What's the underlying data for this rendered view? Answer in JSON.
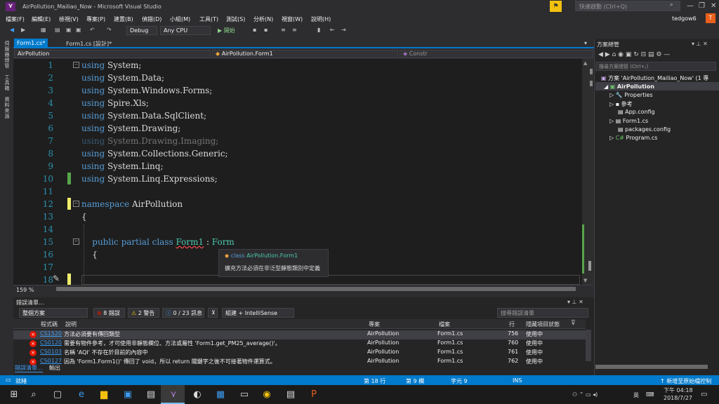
{
  "window": {
    "title": "AirPollution_Mailiao_Now - Microsoft Visual Studio",
    "quick_launch_placeholder": "快速啟動 (Ctrl+Q)",
    "user": "tedgow6",
    "avatar_letter": "T"
  },
  "menu": [
    "檔案(F)",
    "編輯(E)",
    "檢視(V)",
    "專案(P)",
    "建置(B)",
    "偵錯(D)",
    "小組(M)",
    "工具(T)",
    "測試(S)",
    "分析(N)",
    "視窗(W)",
    "說明(H)"
  ],
  "toolbar": {
    "config": "Debug",
    "platform": "Any CPU",
    "start_label": "開始"
  },
  "left_rail": [
    "伺服器總管",
    "工具箱",
    "資料來源"
  ],
  "tabs": [
    {
      "label": "Form1.cs*",
      "active": true
    },
    {
      "label": "Form1.cs [設計]*",
      "active": false
    }
  ],
  "nav": {
    "project": "AirPollution",
    "class": "AirPollution.Form1",
    "member": "Constr"
  },
  "editor": {
    "line_numbers": [
      "1",
      "2",
      "3",
      "4",
      "5",
      "6",
      "7",
      "8",
      "9",
      "10",
      "11",
      "12",
      "13",
      "14",
      "15",
      "16",
      "17",
      "18"
    ],
    "lines": [
      [
        "using",
        " System;"
      ],
      [
        "using",
        " System.Data;"
      ],
      [
        "using",
        " System.Windows.Forms;"
      ],
      [
        "using",
        " Spire.Xls;"
      ],
      [
        "using",
        " System.Data.SqlClient;"
      ],
      [
        "using",
        " System.Drawing;"
      ],
      [
        "using",
        " System.Drawing.Imaging;"
      ],
      [
        "using",
        " System.Collections.Generic;"
      ],
      [
        "using",
        " System.Linq;"
      ],
      [
        "using",
        " System.Linq.Expressions;"
      ],
      [
        "",
        ""
      ],
      [
        "namespace",
        " AirPollution"
      ],
      [
        "",
        "{"
      ],
      [
        "",
        ""
      ],
      [
        "",
        "    public partial class Form1 : Form"
      ],
      [
        "",
        "    {"
      ],
      [
        "",
        ""
      ],
      [
        "",
        ""
      ]
    ],
    "class_decl": {
      "kw": "public partial class",
      "name": "Form1",
      "sep": " : ",
      "base": "Form"
    },
    "zoom": "159 %"
  },
  "tooltip": {
    "kind": "class",
    "name": "AirPollution.Form1",
    "message": "擴充方法必須在非泛型靜態類別中定義"
  },
  "solution_explorer": {
    "title": "方案總管",
    "search_placeholder": "搜尋方案總管 (Ctrl+;)",
    "solution": "方案 'AirPollution_Mailiao_Now' (1 專",
    "project": "AirPollution",
    "items": [
      "Properties",
      "參考",
      "App.config",
      "Form1.cs",
      "packages.config",
      "Program.cs"
    ]
  },
  "error_list": {
    "title": "錯誤清單...",
    "scope": "整個方案",
    "errors_count": "8 錯誤",
    "warnings_count": "2 警告",
    "messages_count": "0 / 23 訊息",
    "filter": "組建 + IntelliSense",
    "search_placeholder": "搜尋錯誤清單",
    "columns": [
      "程式碼",
      "說明",
      "專案",
      "檔案",
      "行",
      "隱藏項目狀態"
    ],
    "rows": [
      {
        "code": "CS1520",
        "desc": "方法必須要有傳回類型",
        "project": "AirPollution",
        "file": "Form1.cs",
        "line": "756",
        "state": "使用中"
      },
      {
        "code": "CS0120",
        "desc": "需要有物件參考，才可使用非靜態欄位、方法或屬性 'Form1.get_PM25_average()'。",
        "project": "AirPollution",
        "file": "Form1.cs",
        "line": "760",
        "state": "使用中"
      },
      {
        "code": "CS0103",
        "desc": "名稱 'AQI' 不存在於目前的內容中",
        "project": "AirPollution",
        "file": "Form1.cs",
        "line": "761",
        "state": "使用中"
      },
      {
        "code": "CS0127",
        "desc": "因為 'Form1.Form1()' 傳回了 void，所以 return 關鍵字之後不可接著物件運算式。",
        "project": "AirPollution",
        "file": "Form1.cs",
        "line": "762",
        "state": "使用中"
      }
    ],
    "bottom_tabs": [
      "錯誤清單...",
      "輸出"
    ]
  },
  "status": {
    "ready": "就緒",
    "line": "第 18 行",
    "col": "第 9 欄",
    "char": "字元 9",
    "ins": "INS",
    "source_control": "新增至原始檔控制"
  },
  "taskbar": {
    "time": "下午 04:18",
    "date": "2018/7/27",
    "ime": "英"
  }
}
